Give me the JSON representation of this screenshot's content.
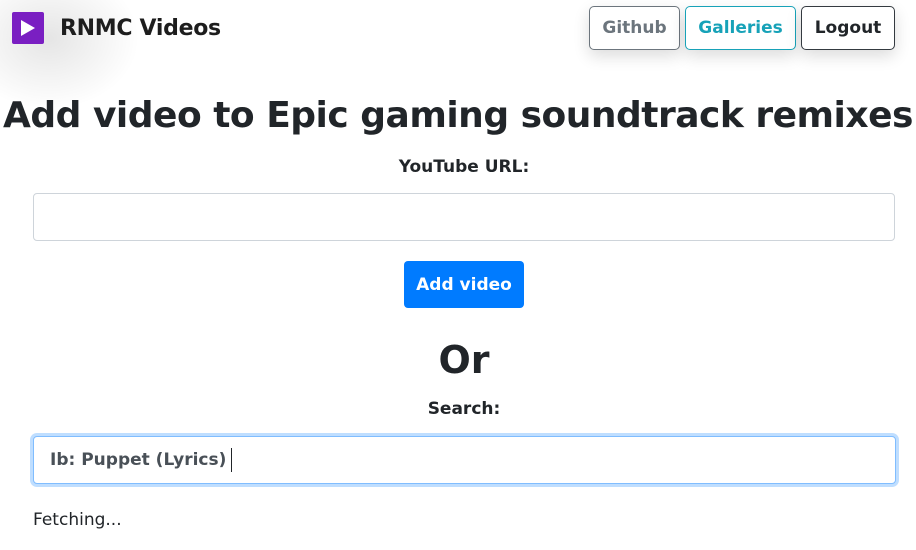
{
  "brand": {
    "name": "RNMC Videos",
    "logo_icon": "play-icon",
    "logo_color": "#7a1fc2"
  },
  "nav": {
    "github_label": "Github",
    "galleries_label": "Galleries",
    "logout_label": "Logout"
  },
  "page": {
    "title": "Add video to Epic gaming soundtrack remixes"
  },
  "url_form": {
    "label": "YouTube URL:",
    "value": "",
    "placeholder": "",
    "submit_label": "Add video"
  },
  "divider": {
    "text": "Or"
  },
  "search": {
    "label": "Search:",
    "value": "Ib: Puppet (Lyrics)"
  },
  "status": {
    "text": "Fetching..."
  },
  "colors": {
    "primary": "#007bff",
    "info": "#17a2b8",
    "secondary": "#6c757d",
    "dark": "#343a40"
  }
}
